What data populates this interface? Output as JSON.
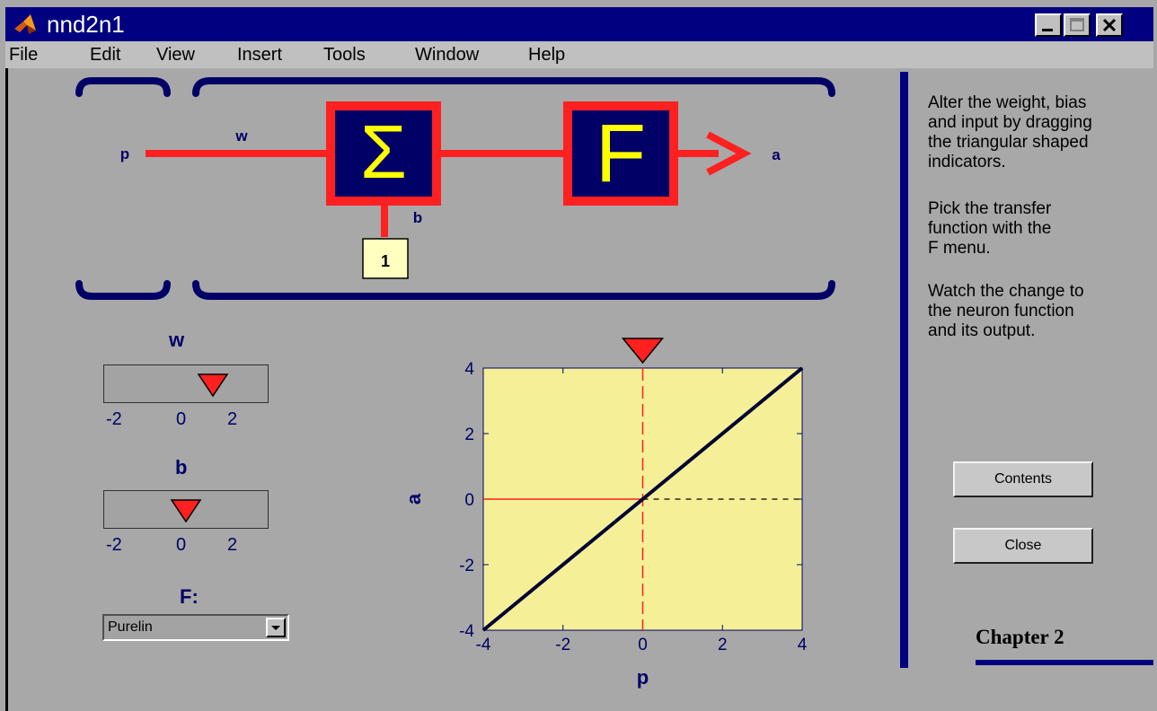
{
  "window": {
    "title": "nnd2n1"
  },
  "menu": [
    {
      "label": "File"
    },
    {
      "label": "Edit"
    },
    {
      "label": "View"
    },
    {
      "label": "Insert"
    },
    {
      "label": "Tools"
    },
    {
      "label": "Window"
    },
    {
      "label": "Help"
    }
  ],
  "diagram": {
    "input_label": "p",
    "weight_label": "w",
    "sum_symbol": "Σ",
    "transfer_symbol": "F",
    "bias_label": "b",
    "bias_input": "1",
    "output_label": "a",
    "colors": {
      "wire": "#ff2020",
      "box_fill": "#000066",
      "box_border": "#ff2020",
      "symbol": "#ffff00",
      "bracket": "#000066"
    }
  },
  "controls": {
    "w": {
      "label": "w",
      "value": 1.0,
      "ticks": [
        "-2",
        "0",
        "2"
      ]
    },
    "b": {
      "label": "b",
      "value": 0.0,
      "ticks": [
        "-2",
        "0",
        "2"
      ]
    },
    "f": {
      "label": "F:",
      "selected": "Purelin"
    }
  },
  "chart_data": {
    "type": "line",
    "xlabel": "p",
    "ylabel": "a",
    "xlim": [
      -4,
      4
    ],
    "ylim": [
      -4,
      4
    ],
    "xticks": [
      "-4",
      "-2",
      "0",
      "2",
      "4"
    ],
    "yticks": [
      "4",
      "2",
      "0",
      "-2",
      "-4"
    ],
    "series": [
      {
        "x": [
          -4,
          4
        ],
        "y": [
          -4,
          4
        ]
      }
    ],
    "input_marker_p": 0,
    "output_a": 0,
    "background": "#f5f098"
  },
  "sidebar": {
    "instructions": [
      "Alter the weight, bias\nand input by dragging\nthe triangular shaped\nindicators.",
      "Pick the transfer\nfunction with the\nF menu.",
      "Watch the change to\nthe neuron function\nand its output."
    ],
    "contents_label": "Contents",
    "close_label": "Close",
    "chapter": "Chapter 2"
  }
}
